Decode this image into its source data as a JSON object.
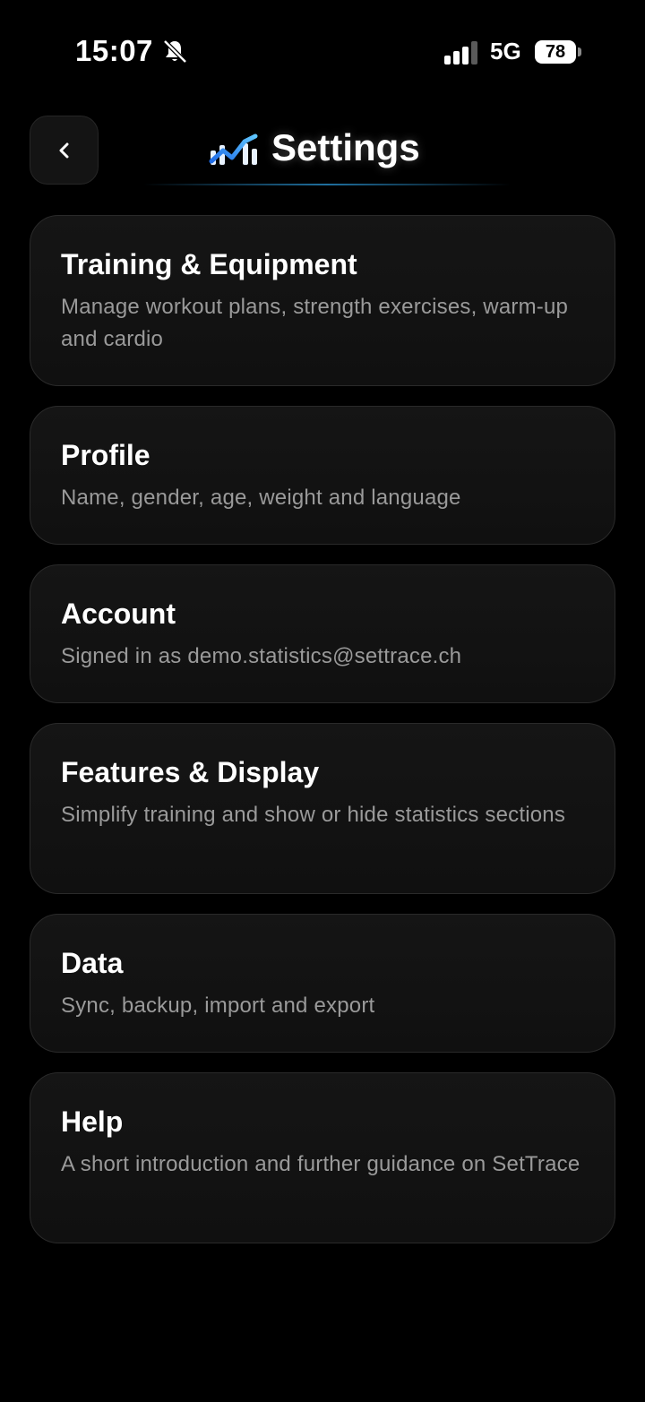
{
  "status_bar": {
    "time": "15:07",
    "network": "5G",
    "battery": "78",
    "icons": [
      "bell-muted-icon",
      "signal-icon",
      "battery-icon"
    ]
  },
  "header": {
    "title": "Settings",
    "back_icon": "chevron-left-icon",
    "logo_icon": "trend-chart-logo-icon",
    "accent_colors": [
      "#1e6be6",
      "#5fc6ff"
    ]
  },
  "cards": [
    {
      "title": "Training & Equipment",
      "subtitle": "Manage workout plans, strength exercises, warm-up and cardio"
    },
    {
      "title": "Profile",
      "subtitle": "Name, gender, age, weight and language"
    },
    {
      "title": "Account",
      "subtitle": "Signed in as demo.statistics@settrace.ch"
    },
    {
      "title": "Features & Display",
      "subtitle": "Simplify training and show or hide statistics sections"
    },
    {
      "title": "Data",
      "subtitle": "Sync, backup, import and export"
    },
    {
      "title": "Help",
      "subtitle": "A short introduction and further guidance on SetTrace"
    }
  ]
}
